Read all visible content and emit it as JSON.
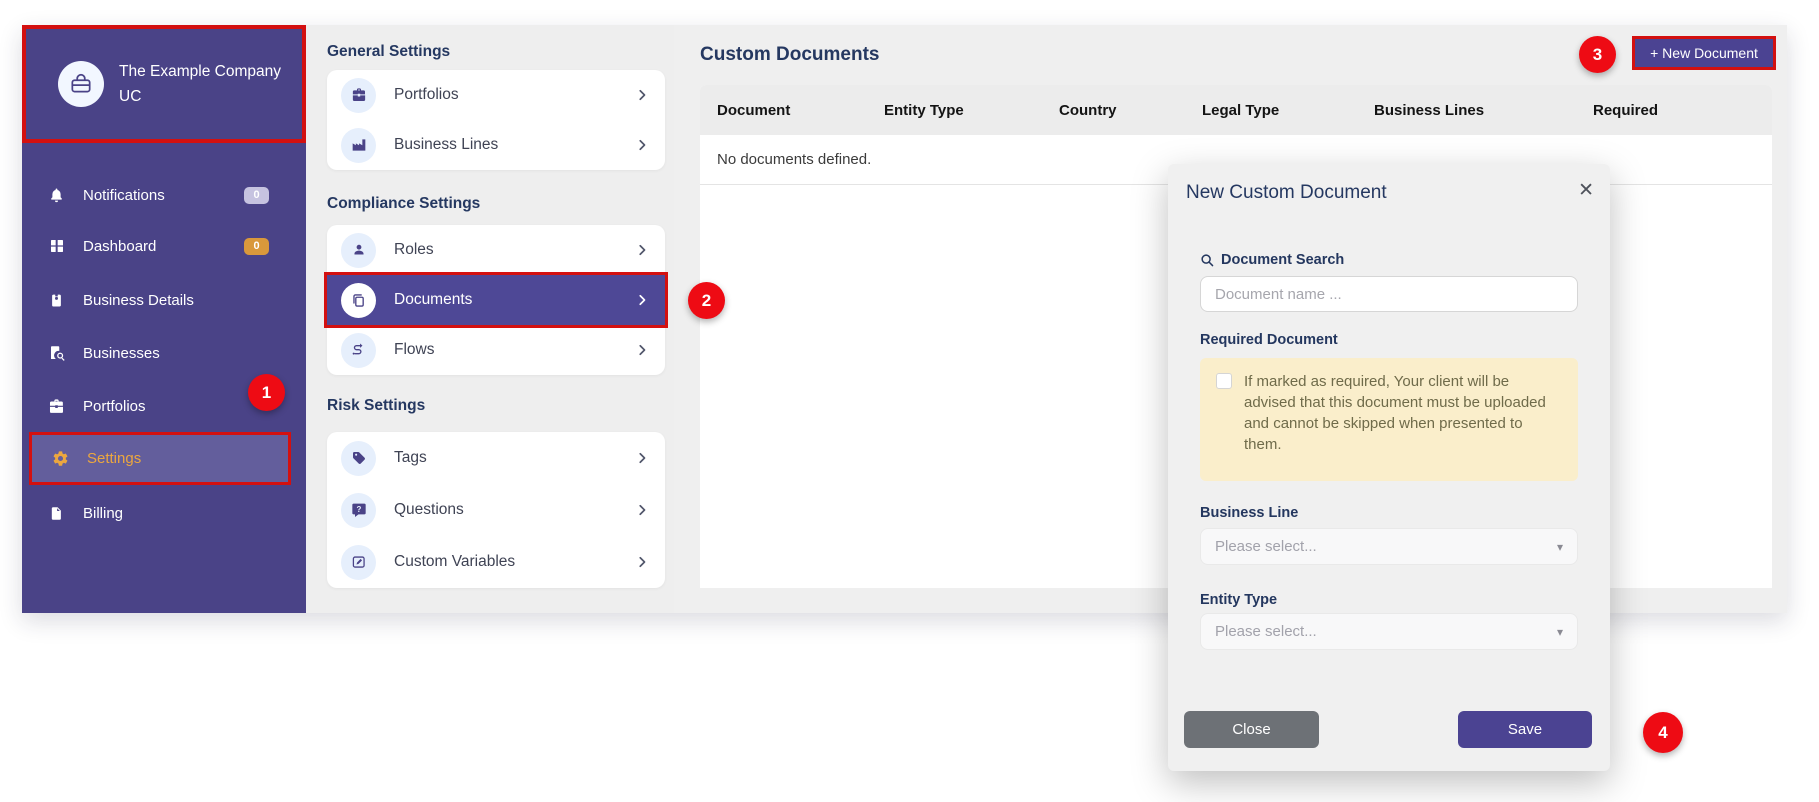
{
  "sidebar": {
    "company_name": "The Example Company UC",
    "items": [
      {
        "label": "Notifications",
        "badge": "0"
      },
      {
        "label": "Dashboard",
        "badge": "0"
      },
      {
        "label": "Business Details"
      },
      {
        "label": "Businesses"
      },
      {
        "label": "Portfolios"
      },
      {
        "label": "Settings"
      },
      {
        "label": "Billing"
      }
    ]
  },
  "settings_menu": {
    "sections": [
      {
        "title": "General Settings",
        "items": [
          {
            "label": "Portfolios"
          },
          {
            "label": "Business Lines"
          }
        ]
      },
      {
        "title": "Compliance Settings",
        "items": [
          {
            "label": "Roles"
          },
          {
            "label": "Documents"
          },
          {
            "label": "Flows"
          }
        ]
      },
      {
        "title": "Risk Settings",
        "items": [
          {
            "label": "Tags"
          },
          {
            "label": "Questions"
          },
          {
            "label": "Custom Variables"
          }
        ]
      }
    ]
  },
  "main": {
    "title": "Custom Documents",
    "new_document_button": "+ New Document",
    "table": {
      "columns": [
        "Document",
        "Entity Type",
        "Country",
        "Legal Type",
        "Business Lines",
        "Required"
      ],
      "empty_message": "No documents defined."
    }
  },
  "modal": {
    "title": "New Custom Document",
    "close_icon": "✕",
    "document_search_label": "Document Search",
    "document_search_placeholder": "Document name ...",
    "required_document_label": "Required Document",
    "required_note": "If marked as required, Your client will be advised that this document must be uploaded and cannot be skipped when presented to them.",
    "business_line_label": "Business Line",
    "business_line_value": "Please select...",
    "entity_type_label": "Entity Type",
    "entity_type_value": "Please select...",
    "close_button": "Close",
    "save_button": "Save"
  },
  "annotations": {
    "step_1": "1",
    "step_2": "2",
    "step_3": "3",
    "step_4": "4",
    "highlight_color": "#d31010",
    "badge_color": "#ee0b14"
  },
  "colors": {
    "sidebar_purple": "#4a4387",
    "accent_purple": "#4b4392",
    "accent_orange": "#e9a440",
    "heading_navy": "#253861",
    "note_bg": "#faeecb"
  }
}
